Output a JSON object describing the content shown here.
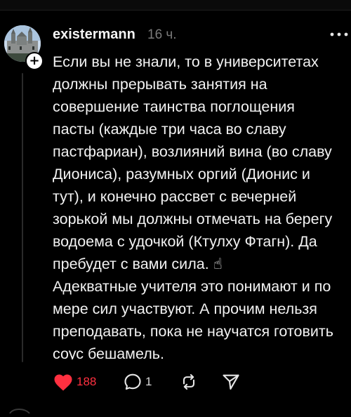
{
  "post": {
    "username": "existermann",
    "time": "16 ч.",
    "follow_glyph": "+",
    "lines": [
      "Если вы не знали, то в университетах",
      "должны прерывать занятия на",
      "совершение таинства поглощения",
      "пасты (каждые три часа во славу",
      "пастфариан), возлияний вина (во славу",
      "Диониса), разумных оргий (Дионис и",
      "тут), и конечно рассвет с вечерней",
      "зорькой мы должны отмечать на берегу",
      "водоема с удочкой (Ктулху Фтагн). Да",
      "пребудет с вами сила. ☝",
      "Адекватные учителя это понимают и по",
      "мере сил участвуют. А прочим нельзя",
      "преподавать, пока не научатся готовить",
      "соус бешамель."
    ]
  },
  "actions": {
    "like_count": "188",
    "comment_count": "1"
  },
  "icons": {
    "like": "heart-filled-icon",
    "comment": "comment-icon",
    "repost": "repost-icon",
    "share": "send-icon",
    "more": "more-dots-icon"
  },
  "colors": {
    "background": "#000000",
    "text": "#f2f2f2",
    "muted": "#7a7a7a",
    "like": "#ff3040"
  }
}
